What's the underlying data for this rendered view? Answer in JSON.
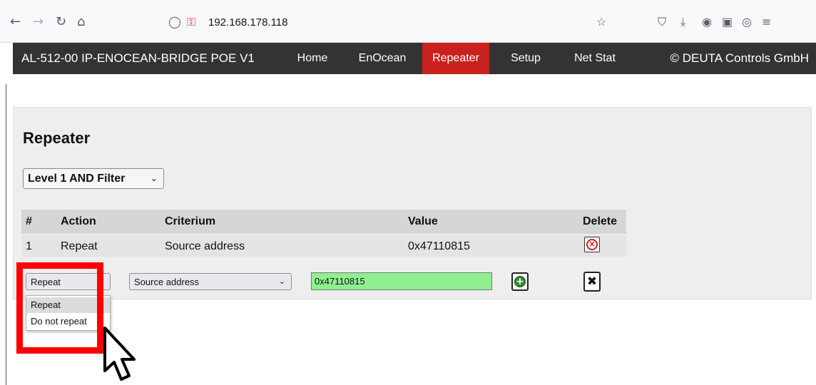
{
  "browser": {
    "back_icon": "arrow-left-icon",
    "url": "192.168.178.118"
  },
  "site": {
    "title": "AL-512-00 IP-ENOCEAN-BRIDGE POE V1",
    "nav": [
      "Home",
      "EnOcean",
      "Repeater",
      "Setup",
      "Net Stat"
    ],
    "active": "Repeater",
    "copyright": "© DEUTA Controls GmbH",
    "accent_color": "#c9211e",
    "nav_bg": "#333333"
  },
  "page": {
    "heading": "Repeater",
    "level_select": "Level 1 AND Filter"
  },
  "table": {
    "headers": [
      "#",
      "Action",
      "Criterium",
      "Value",
      "Delete"
    ],
    "rows": [
      {
        "index": "1",
        "action": "Repeat",
        "criterium": "Source address",
        "value": "0x47110815"
      }
    ]
  },
  "new_row": {
    "action": "Repeat",
    "criterium": "Source address",
    "value": "0x47110815"
  },
  "dropdown": {
    "options": [
      "Repeat",
      "Do not repeat"
    ],
    "highlighted": "Repeat"
  }
}
